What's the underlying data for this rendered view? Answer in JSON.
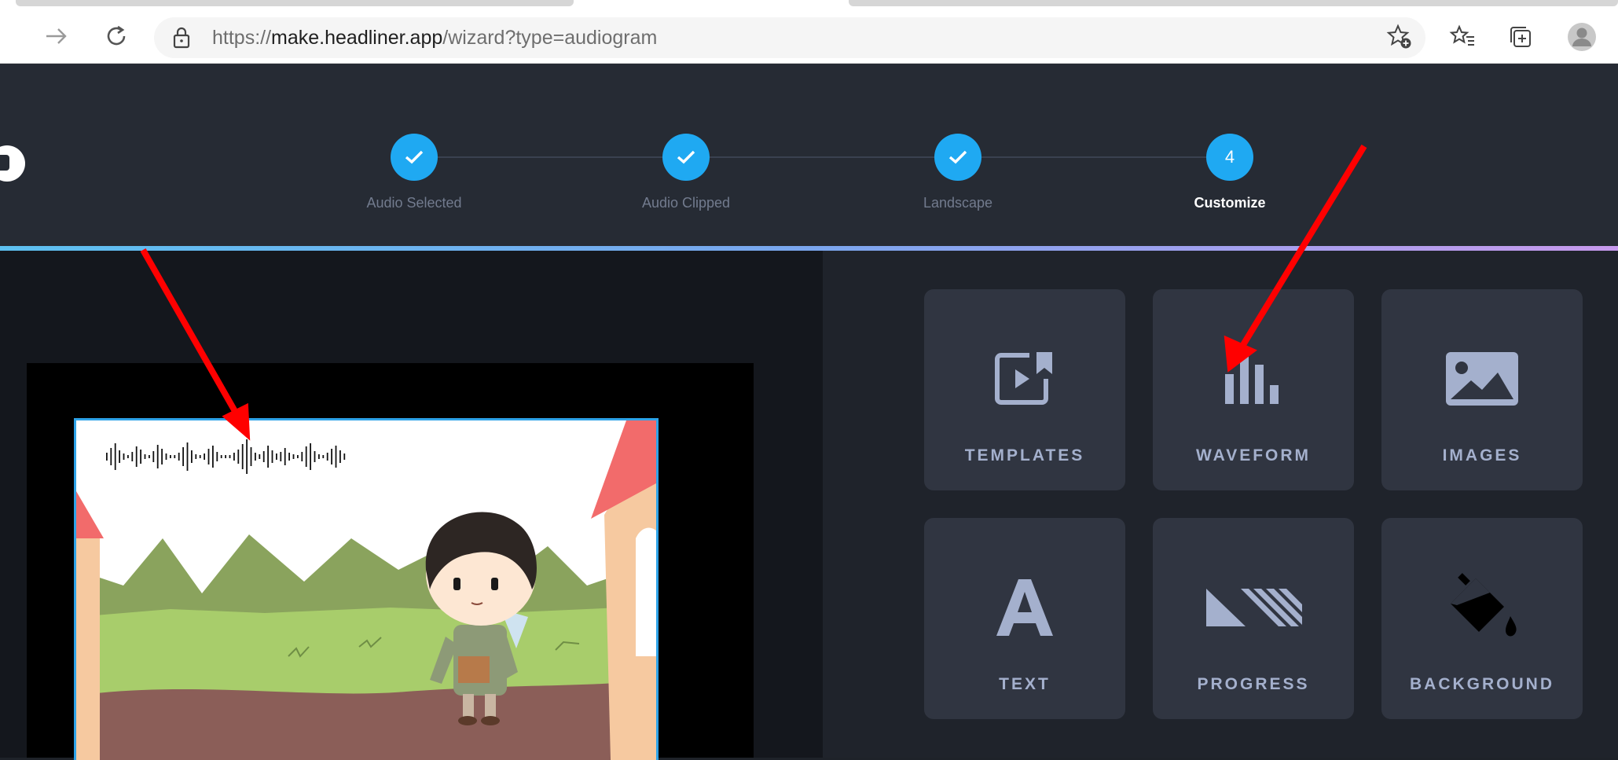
{
  "browser": {
    "url_prefix": "https://",
    "url_host": "make.headliner.app",
    "url_path": "/wizard?type=audiogram"
  },
  "wizard": {
    "steps": [
      {
        "label": "Audio Selected",
        "state": "complete"
      },
      {
        "label": "Audio Clipped",
        "state": "complete"
      },
      {
        "label": "Landscape",
        "state": "complete"
      },
      {
        "label": "Customize",
        "state": "current",
        "number": "4"
      }
    ]
  },
  "tools": [
    {
      "label": "TEMPLATES",
      "icon": "templates-icon"
    },
    {
      "label": "WAVEFORM",
      "icon": "waveform-icon"
    },
    {
      "label": "IMAGES",
      "icon": "images-icon"
    },
    {
      "label": "TEXT",
      "icon": "text-icon"
    },
    {
      "label": "PROGRESS",
      "icon": "progress-icon"
    },
    {
      "label": "BACKGROUND",
      "icon": "background-icon"
    }
  ],
  "colors": {
    "accent": "#1fa9f2",
    "annotation_arrow": "#ff0000",
    "tile_bg": "#303541",
    "tile_label": "#a4b0cd"
  }
}
